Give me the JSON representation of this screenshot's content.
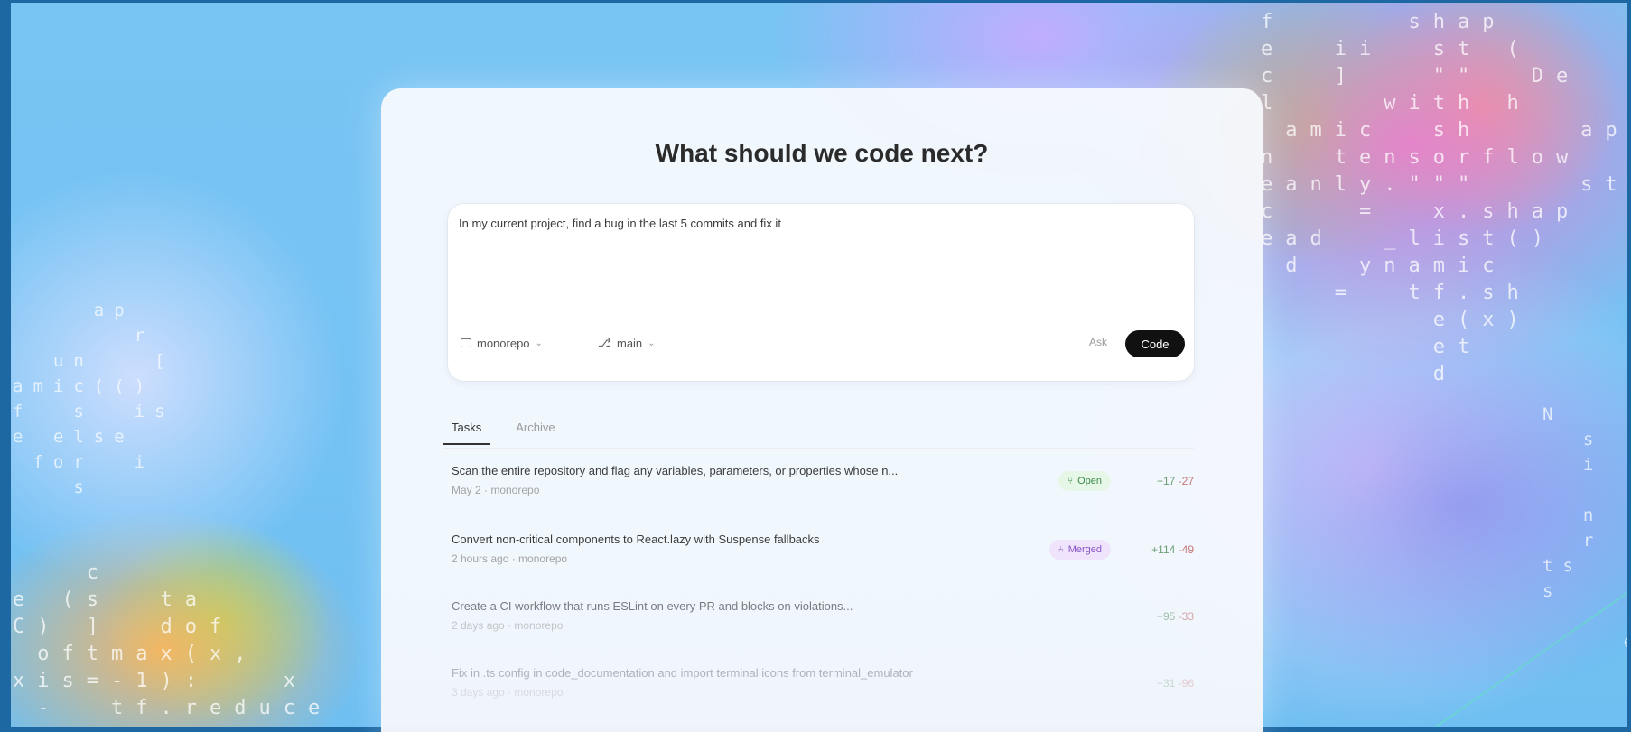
{
  "page": {
    "heading": "What should we code next?"
  },
  "composer": {
    "input_value": "In my current project, find a bug in the last 5 commits and fix it",
    "repo_label": "monorepo",
    "branch_label": "main",
    "ask_label": "Ask",
    "code_label": "Code"
  },
  "tabs": [
    {
      "label": "Tasks",
      "active": true
    },
    {
      "label": "Archive",
      "active": false
    }
  ],
  "tasks": [
    {
      "title": "Scan the entire repository and flag any variables, parameters, or properties whose n...",
      "meta": "May 2 · monorepo",
      "badge": "Open",
      "additions": "+17",
      "deletions": "-27"
    },
    {
      "title": "Convert non-critical components to React.lazy with Suspense fallbacks",
      "meta": "2 hours ago · monorepo",
      "badge": "Merged",
      "additions": "+114",
      "deletions": "-49"
    },
    {
      "title": "Create a CI workflow that runs ESLint on every PR and blocks on violations...",
      "meta": "2 days ago · monorepo",
      "badge": "",
      "additions": "+95",
      "deletions": "-33"
    },
    {
      "title": "Fix in .ts config in code_documentation and import terminal icons from terminal_emulator",
      "meta": "3 days ago · monorepo",
      "badge": "",
      "additions": "+31",
      "deletions": "-96"
    }
  ],
  "theme": {
    "accent": "#111111",
    "open_badge_bg": "#e6f6e7",
    "merged_badge_bg": "#efe4fb"
  },
  "background_code": {
    "top_right": "f     shap\ne  ii  st (\nc  ]   \"\"  De  a\nl    with h    dp\n amic  sh    ap\nn  tensorflow\neanly.\"\"\"    sta\nc   =  x.shap\nead  _list()\n d  ynamic\n   =  tf.sh\n       e(x)\n       et\n       d",
    "left": "    ap\n      r\n  un   [\namic(()\nf  s  is\ne else\n for  i\n   s",
    "bottom_left": "   c\ne (s  ta\nC) ]  dof\n oftmax(x,\nxis=-1):   x\n -  tf.reduce",
    "right": "N\n  s\n  i\n\n  n\n  r\nts\ns\n\n    e"
  }
}
